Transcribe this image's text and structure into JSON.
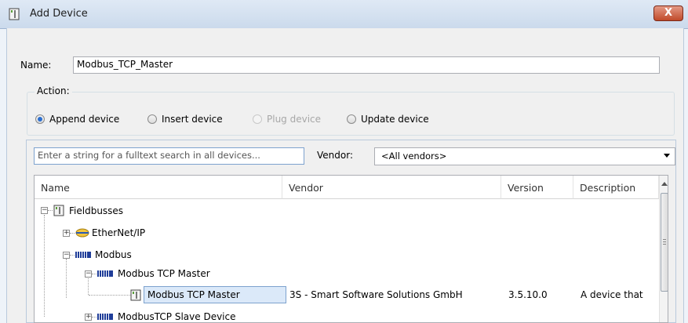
{
  "window": {
    "title": "Add Device",
    "close_label": "X"
  },
  "name": {
    "label": "Name:",
    "value": "Modbus_TCP_Master"
  },
  "action": {
    "title": "Action:",
    "options": [
      {
        "label": "Append device",
        "checked": true,
        "disabled": false
      },
      {
        "label": "Insert device",
        "checked": false,
        "disabled": false
      },
      {
        "label": "Plug device",
        "checked": false,
        "disabled": true
      },
      {
        "label": "Update device",
        "checked": false,
        "disabled": false
      }
    ]
  },
  "search": {
    "placeholder": "Enter a string for a fulltext search in all devices..."
  },
  "vendor": {
    "label": "Vendor:",
    "selected": "<All vendors>"
  },
  "tree": {
    "columns": [
      "Name",
      "Vendor",
      "Version",
      "Description"
    ],
    "rows": [
      {
        "name": "Fieldbusses",
        "icon": "device-folder-icon",
        "expander": "minus"
      },
      {
        "name": "EtherNet/IP",
        "icon": "ethernet-ip-icon",
        "expander": "plus"
      },
      {
        "name": "Modbus",
        "icon": "fieldbus-bars-icon",
        "expander": "minus"
      },
      {
        "name": "Modbus TCP Master",
        "icon": "fieldbus-bars-icon",
        "expander": "minus"
      },
      {
        "name": "Modbus TCP Master",
        "icon": "device-icon",
        "vendor": "3S - Smart Software Solutions GmbH",
        "version": "3.5.10.0",
        "description": "A device that",
        "selected": true
      },
      {
        "name": "ModbusTCP Slave Device",
        "icon": "fieldbus-bars-icon",
        "expander": "plus"
      }
    ]
  }
}
